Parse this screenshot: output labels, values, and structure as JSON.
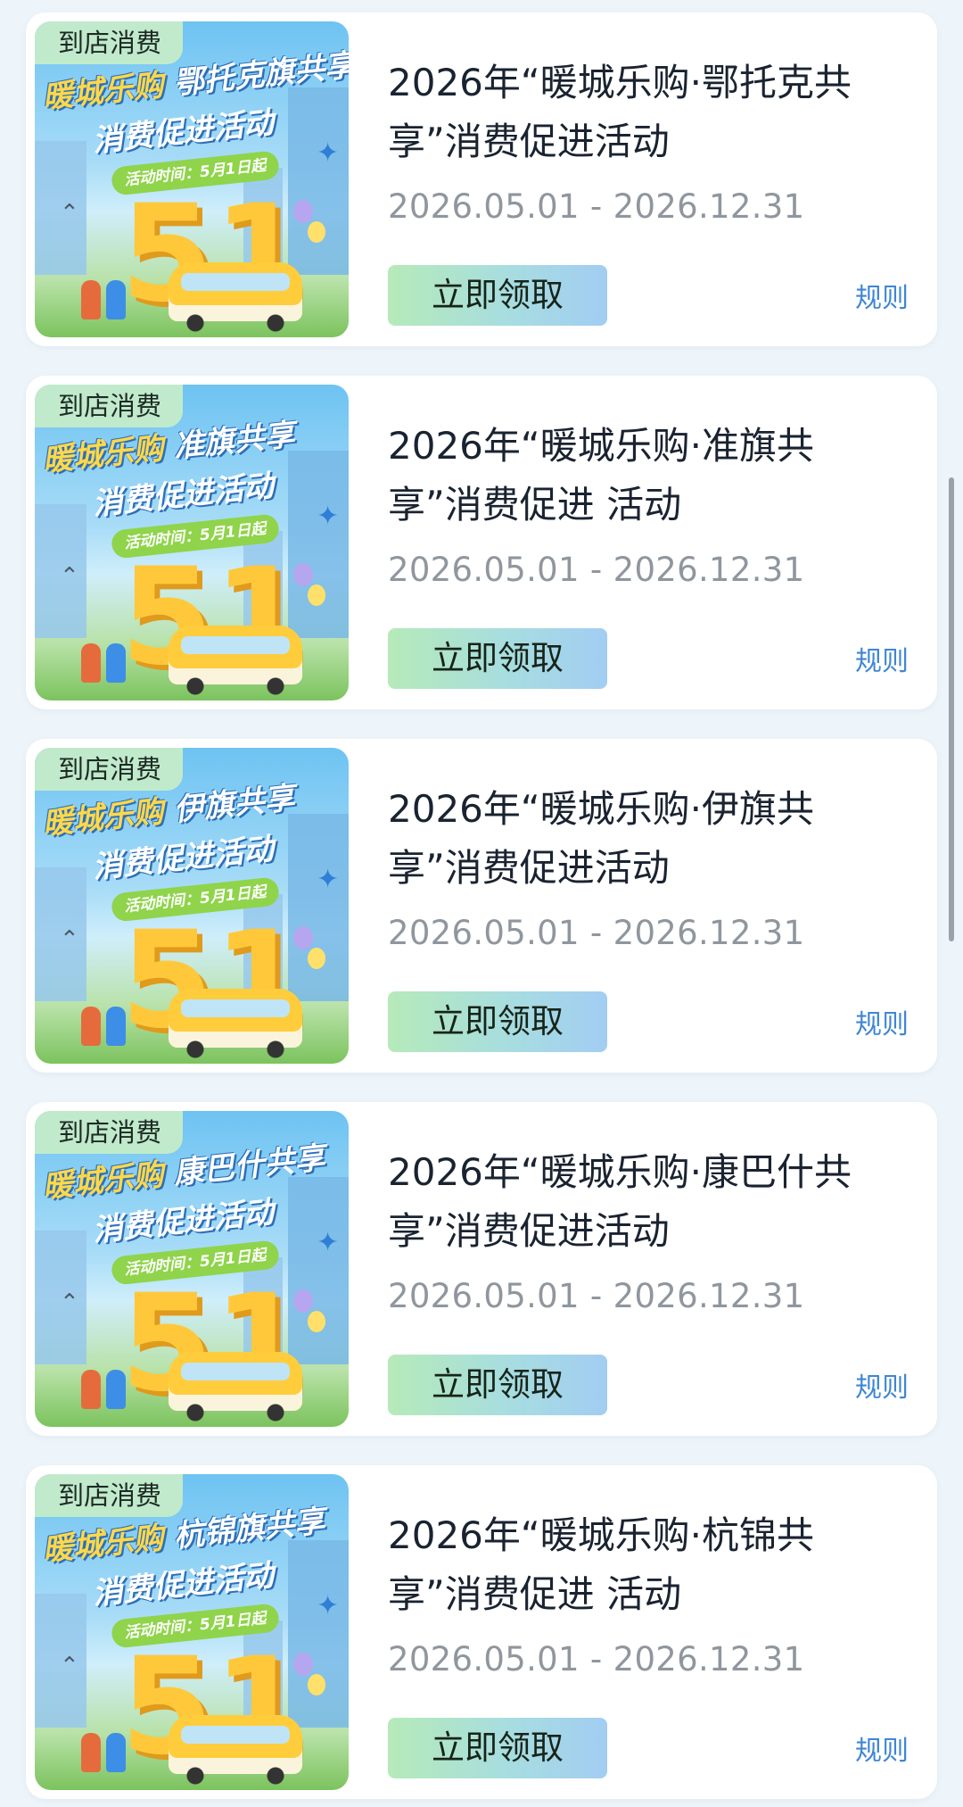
{
  "activities": [
    {
      "tag": "到店消费",
      "banner_line1": "暖城乐购",
      "banner_line1_sub": "鄂托克旗共享",
      "banner_line2": "消费促进活动",
      "banner_time": "活动时间：5月1日起",
      "banner_number": "51",
      "title": "2026年“暖城乐购·鄂托克共享”消费促进活动",
      "date": "2026.05.01 - 2026.12.31",
      "claim_label": "立即领取",
      "rule_label": "规则"
    },
    {
      "tag": "到店消费",
      "banner_line1": "暖城乐购",
      "banner_line1_sub": "准旗共享",
      "banner_line2": "消费促进活动",
      "banner_time": "活动时间：5月1日起",
      "banner_number": "51",
      "title": "2026年“暖城乐购·准旗共享”消费促进 活动",
      "date": "2026.05.01 - 2026.12.31",
      "claim_label": "立即领取",
      "rule_label": "规则"
    },
    {
      "tag": "到店消费",
      "banner_line1": "暖城乐购",
      "banner_line1_sub": "伊旗共享",
      "banner_line2": "消费促进活动",
      "banner_time": "活动时间：5月1日起",
      "banner_number": "51",
      "title": "2026年“暖城乐购·伊旗共享”消费促进活动",
      "date": "2026.05.01 - 2026.12.31",
      "claim_label": "立即领取",
      "rule_label": "规则"
    },
    {
      "tag": "到店消费",
      "banner_line1": "暖城乐购",
      "banner_line1_sub": "康巴什共享",
      "banner_line2": "消费促进活动",
      "banner_time": "活动时间：5月1日起",
      "banner_number": "51",
      "title": "2026年“暖城乐购·康巴什共享”消费促进活动",
      "date": "2026.05.01 - 2026.12.31",
      "claim_label": "立即领取",
      "rule_label": "规则"
    },
    {
      "tag": "到店消费",
      "banner_line1": "暖城乐购",
      "banner_line1_sub": "杭锦旗共享",
      "banner_line2": "消费促进活动",
      "banner_time": "活动时间：5月1日起",
      "banner_number": "51",
      "title": "2026年“暖城乐购·杭锦共享”消费促进 活动",
      "date": "2026.05.01 - 2026.12.31",
      "claim_label": "立即领取",
      "rule_label": "规则"
    }
  ],
  "colors": {
    "page_bg": "#eef5fa",
    "card_bg": "#ffffff",
    "rule_link": "#3f86d4",
    "date_text": "#8f969e",
    "claim_button_gradient": [
      "#b6eab9",
      "#a2cdf3"
    ],
    "tag_bg": "#c4ecc8"
  }
}
